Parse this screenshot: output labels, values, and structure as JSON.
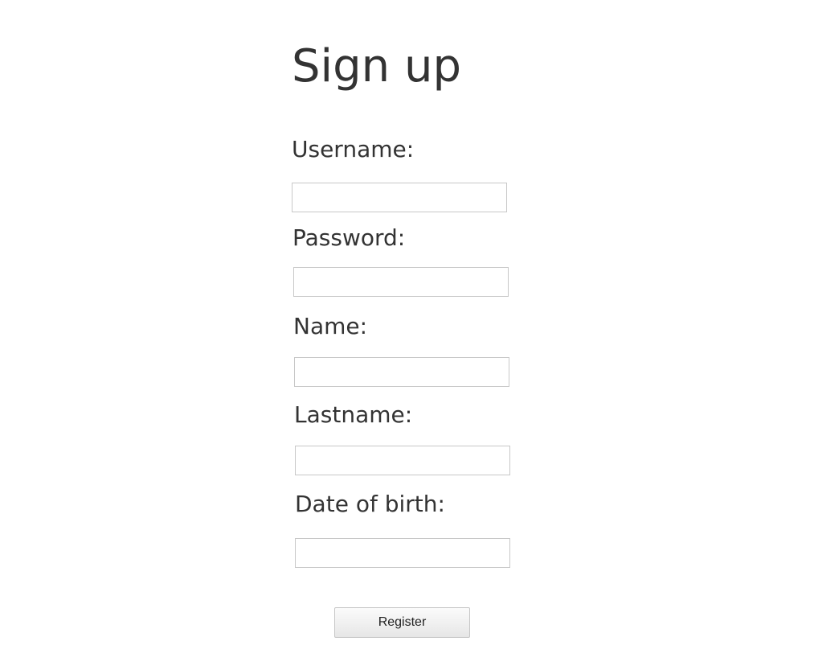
{
  "page": {
    "title": "Sign up"
  },
  "form": {
    "username": {
      "label": "Username:",
      "value": "",
      "placeholder": ""
    },
    "password": {
      "label": "Password:",
      "value": "",
      "placeholder": ""
    },
    "name": {
      "label": "Name:",
      "value": "",
      "placeholder": ""
    },
    "lastname": {
      "label": "Lastname:",
      "value": "",
      "placeholder": ""
    },
    "date_of_birth": {
      "label": "Date of birth:",
      "value": "",
      "placeholder": ""
    },
    "submit_label": "Register"
  },
  "colors": {
    "text": "#333333",
    "input_border": "#c8c8c8",
    "button_border": "#c6c6c6"
  }
}
